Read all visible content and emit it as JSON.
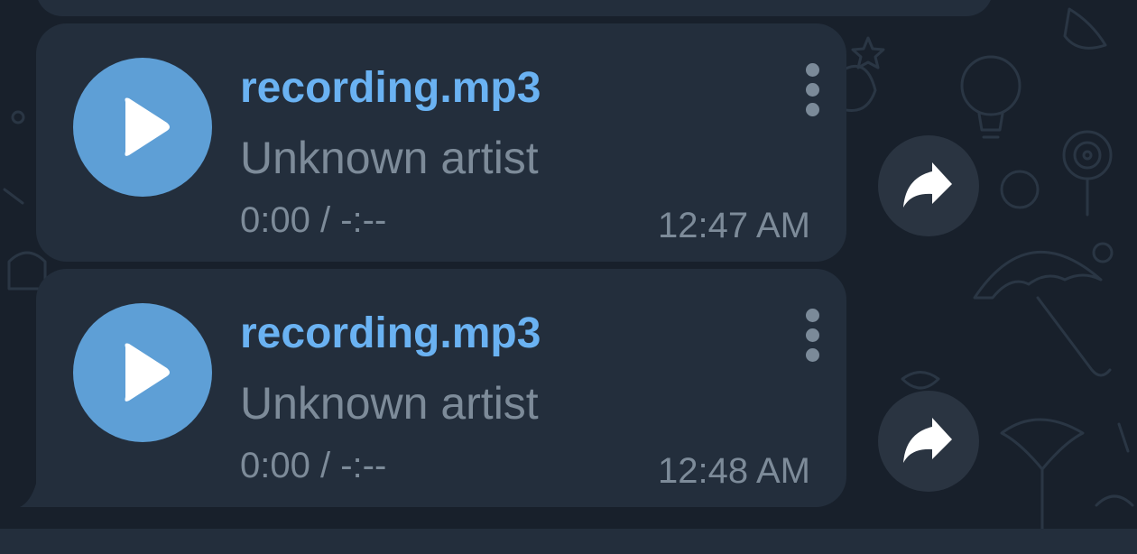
{
  "messages": [
    {
      "title": "recording.mp3",
      "artist": "Unknown artist",
      "duration": "0:00 / -:--",
      "time": "12:47 AM"
    },
    {
      "title": "recording.mp3",
      "artist": "Unknown artist",
      "duration": "0:00 / -:--",
      "time": "12:48 AM"
    }
  ],
  "icons": {
    "play": "play-icon",
    "menu": "more-vertical-icon",
    "share": "share-forward-icon"
  },
  "colors": {
    "background": "#18202b",
    "bubble": "#232e3c",
    "accent": "#6ab2f2",
    "play_button": "#5e9fd6",
    "secondary_text": "#7d8b99",
    "share_button": "#2a3441"
  }
}
